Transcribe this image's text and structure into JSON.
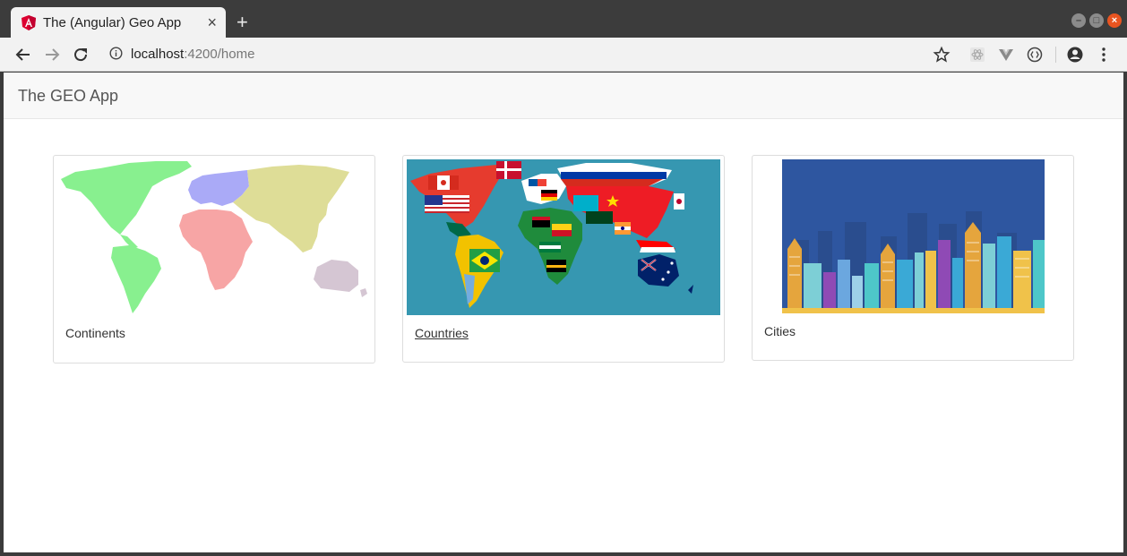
{
  "browser": {
    "tab_title": "The (Angular) Geo App",
    "url_host": "localhost",
    "url_path": ":4200/home"
  },
  "app": {
    "brand": "The GEO App"
  },
  "cards": [
    {
      "label": "Continents"
    },
    {
      "label": "Countries"
    },
    {
      "label": "Cities"
    }
  ]
}
